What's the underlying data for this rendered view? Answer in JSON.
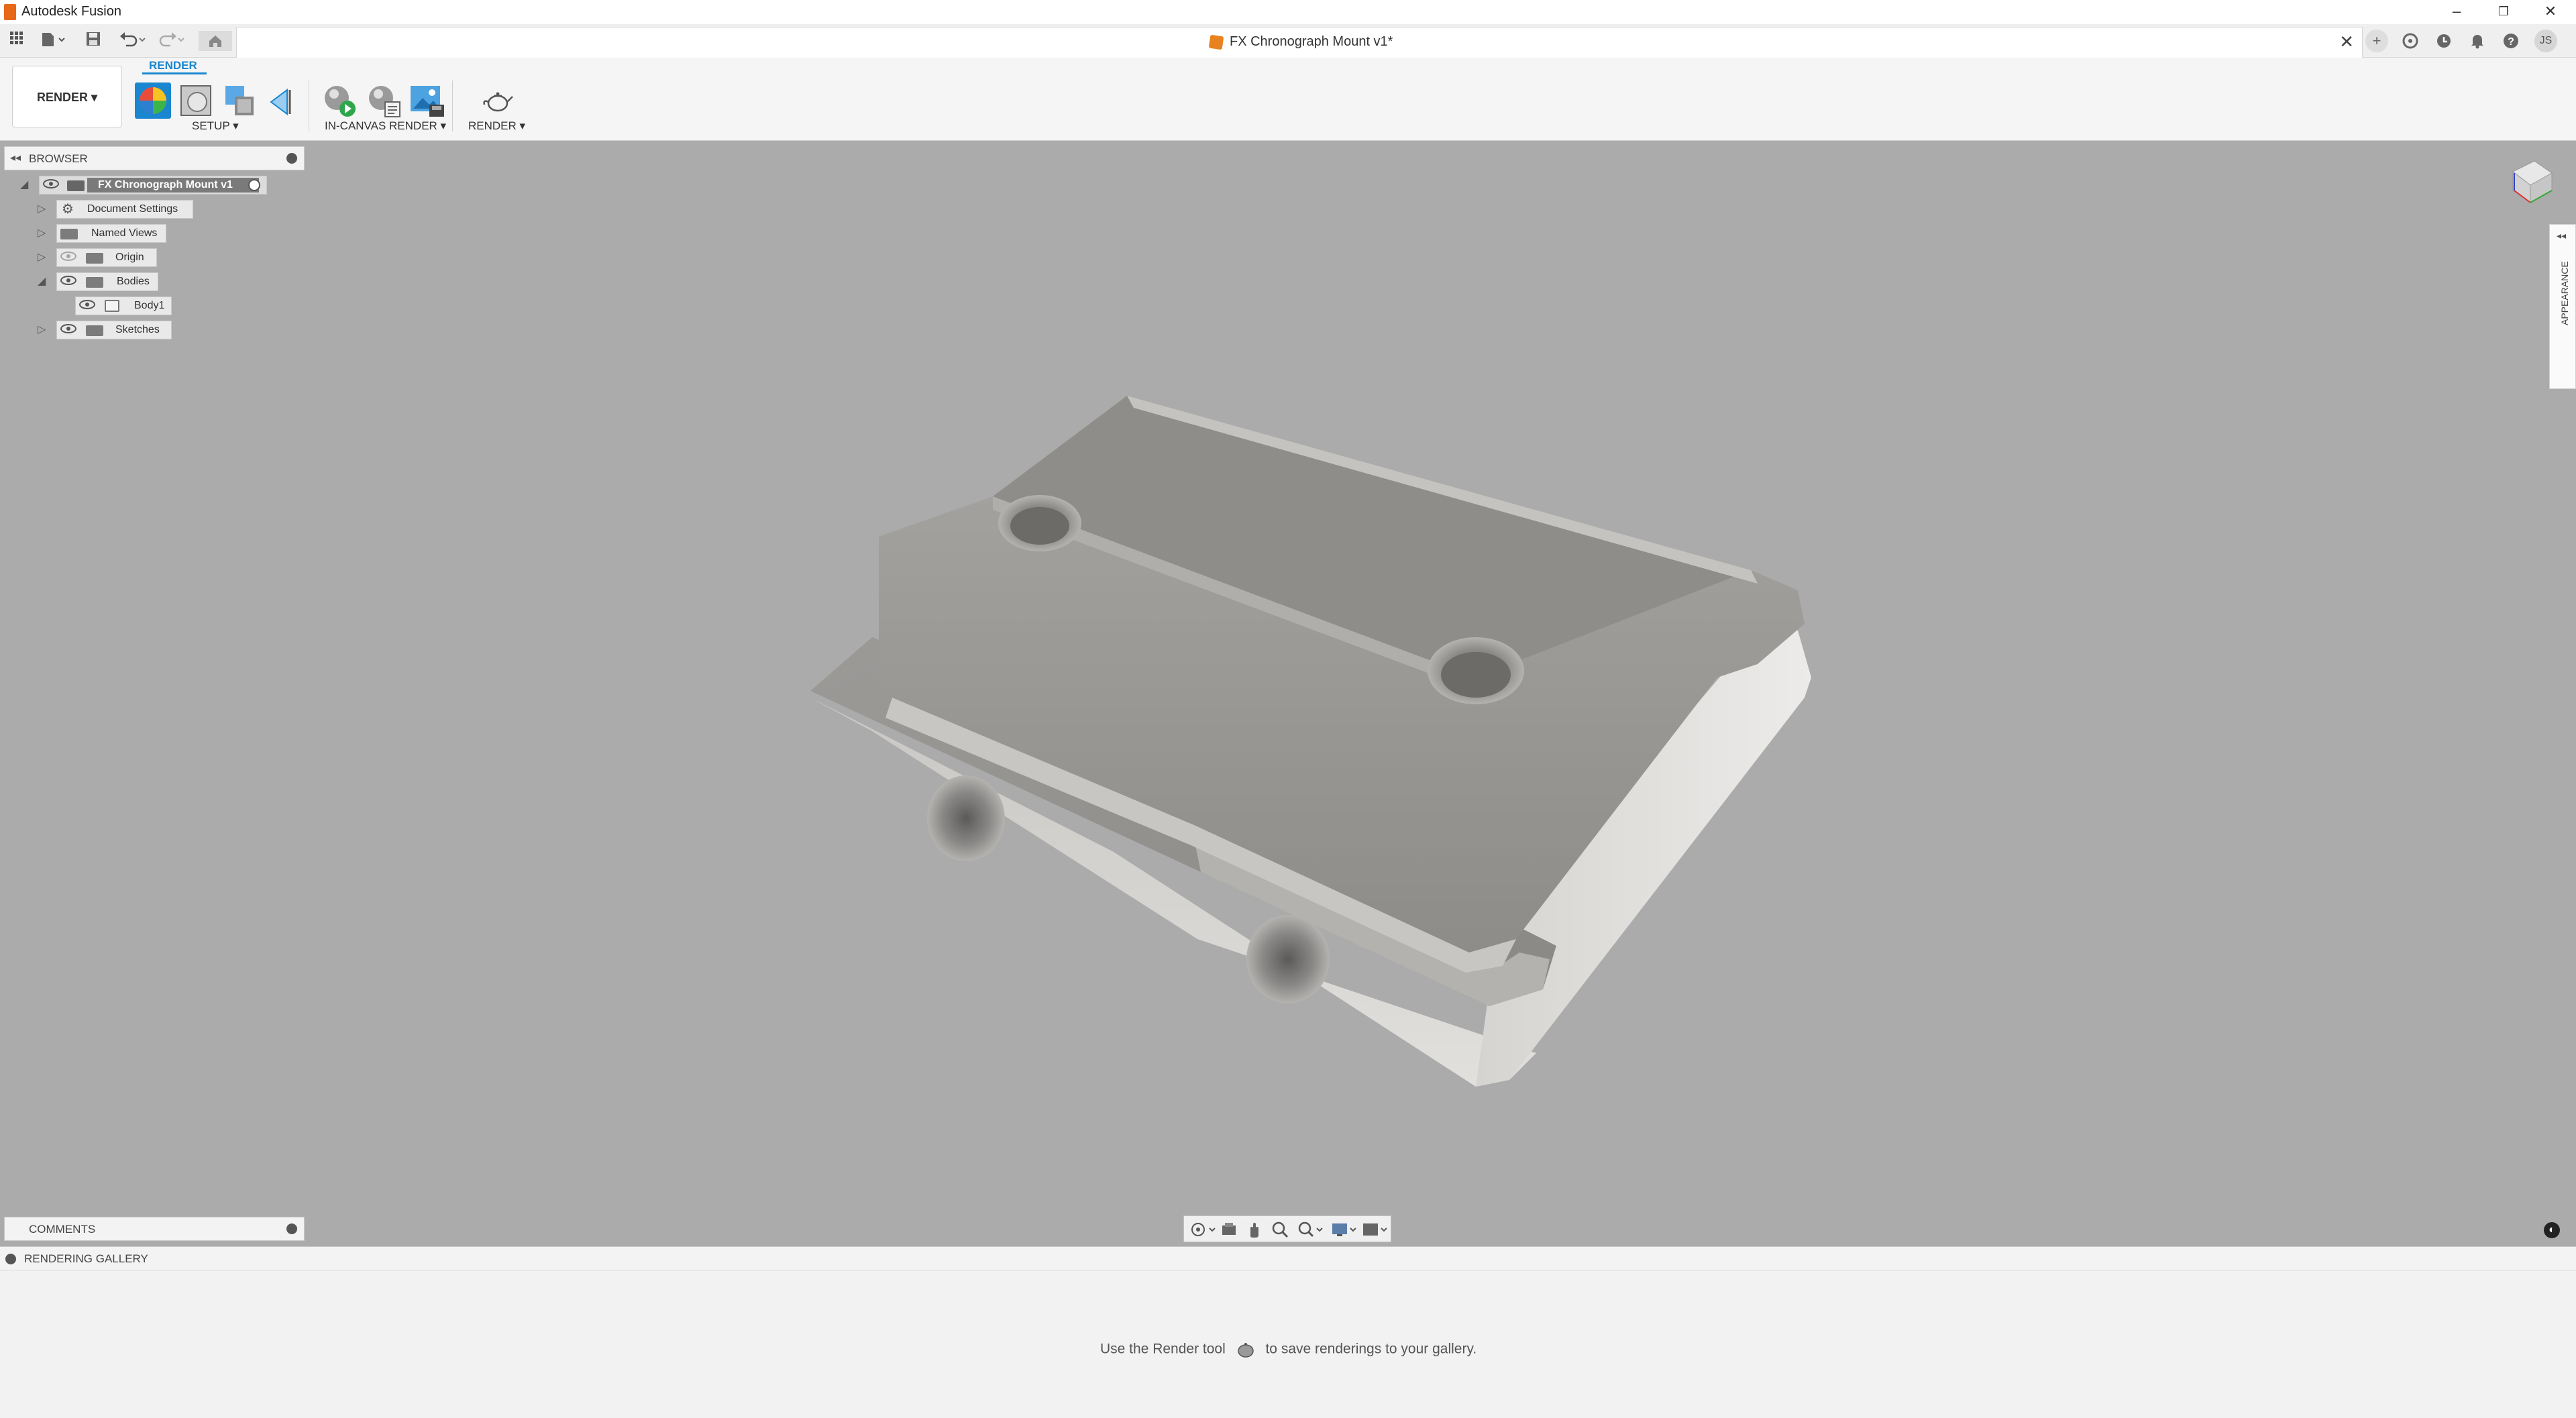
{
  "app": {
    "title": "Autodesk Fusion"
  },
  "window_controls": {
    "minimize": "–",
    "restore": "❐",
    "close": "✕"
  },
  "document_tab": {
    "title": "FX Chronograph Mount v1*",
    "close": "✕"
  },
  "user": {
    "initials": "JS"
  },
  "toolbar": {
    "workspace": "RENDER ▾",
    "active_tab": "RENDER",
    "groups": {
      "setup": "SETUP ▾",
      "in_canvas_render": "IN-CANVAS RENDER ▾",
      "render": "RENDER ▾"
    }
  },
  "browser": {
    "title": "BROWSER",
    "root": "FX Chronograph Mount v1",
    "items": [
      {
        "label": "Document Settings"
      },
      {
        "label": "Named Views"
      },
      {
        "label": "Origin"
      },
      {
        "label": "Bodies"
      },
      {
        "label": "Body1"
      },
      {
        "label": "Sketches"
      }
    ]
  },
  "appearance_panel": {
    "label": "APPEARANCE"
  },
  "comments": {
    "title": "COMMENTS"
  },
  "rendering_gallery": {
    "title": "RENDERING GALLERY",
    "message_before": "Use the Render tool",
    "message_after": "to save renderings to your gallery."
  },
  "colors": {
    "accent": "#1a86d0",
    "viewport_bg": "#ababab",
    "logo": "#e8681a"
  }
}
